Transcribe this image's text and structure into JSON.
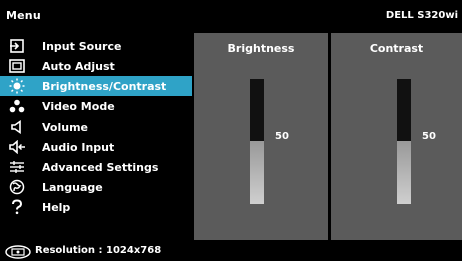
{
  "header": {
    "menu_title": "Menu",
    "model": "DELL S320wi"
  },
  "menu": {
    "items": [
      {
        "label": "Input Source",
        "icon": "input-source-icon",
        "selected": false
      },
      {
        "label": "Auto Adjust",
        "icon": "auto-adjust-icon",
        "selected": false
      },
      {
        "label": "Brightness/Contrast",
        "icon": "brightness-icon",
        "selected": true
      },
      {
        "label": "Video Mode",
        "icon": "video-mode-icon",
        "selected": false
      },
      {
        "label": "Volume",
        "icon": "volume-icon",
        "selected": false
      },
      {
        "label": "Audio Input",
        "icon": "audio-input-icon",
        "selected": false
      },
      {
        "label": "Advanced Settings",
        "icon": "advanced-settings-icon",
        "selected": false
      },
      {
        "label": "Language",
        "icon": "language-icon",
        "selected": false
      },
      {
        "label": "Help",
        "icon": "help-icon",
        "selected": false
      }
    ]
  },
  "panels": {
    "brightness": {
      "title": "Brightness",
      "value": "50",
      "level_percent": 50
    },
    "contrast": {
      "title": "Contrast",
      "value": "50",
      "level_percent": 50
    }
  },
  "status": {
    "resolution": "Resolution : 1024x768"
  },
  "colors": {
    "selected": "#2fa3c7",
    "panel": "#5b5b5b",
    "background": "#000000"
  }
}
